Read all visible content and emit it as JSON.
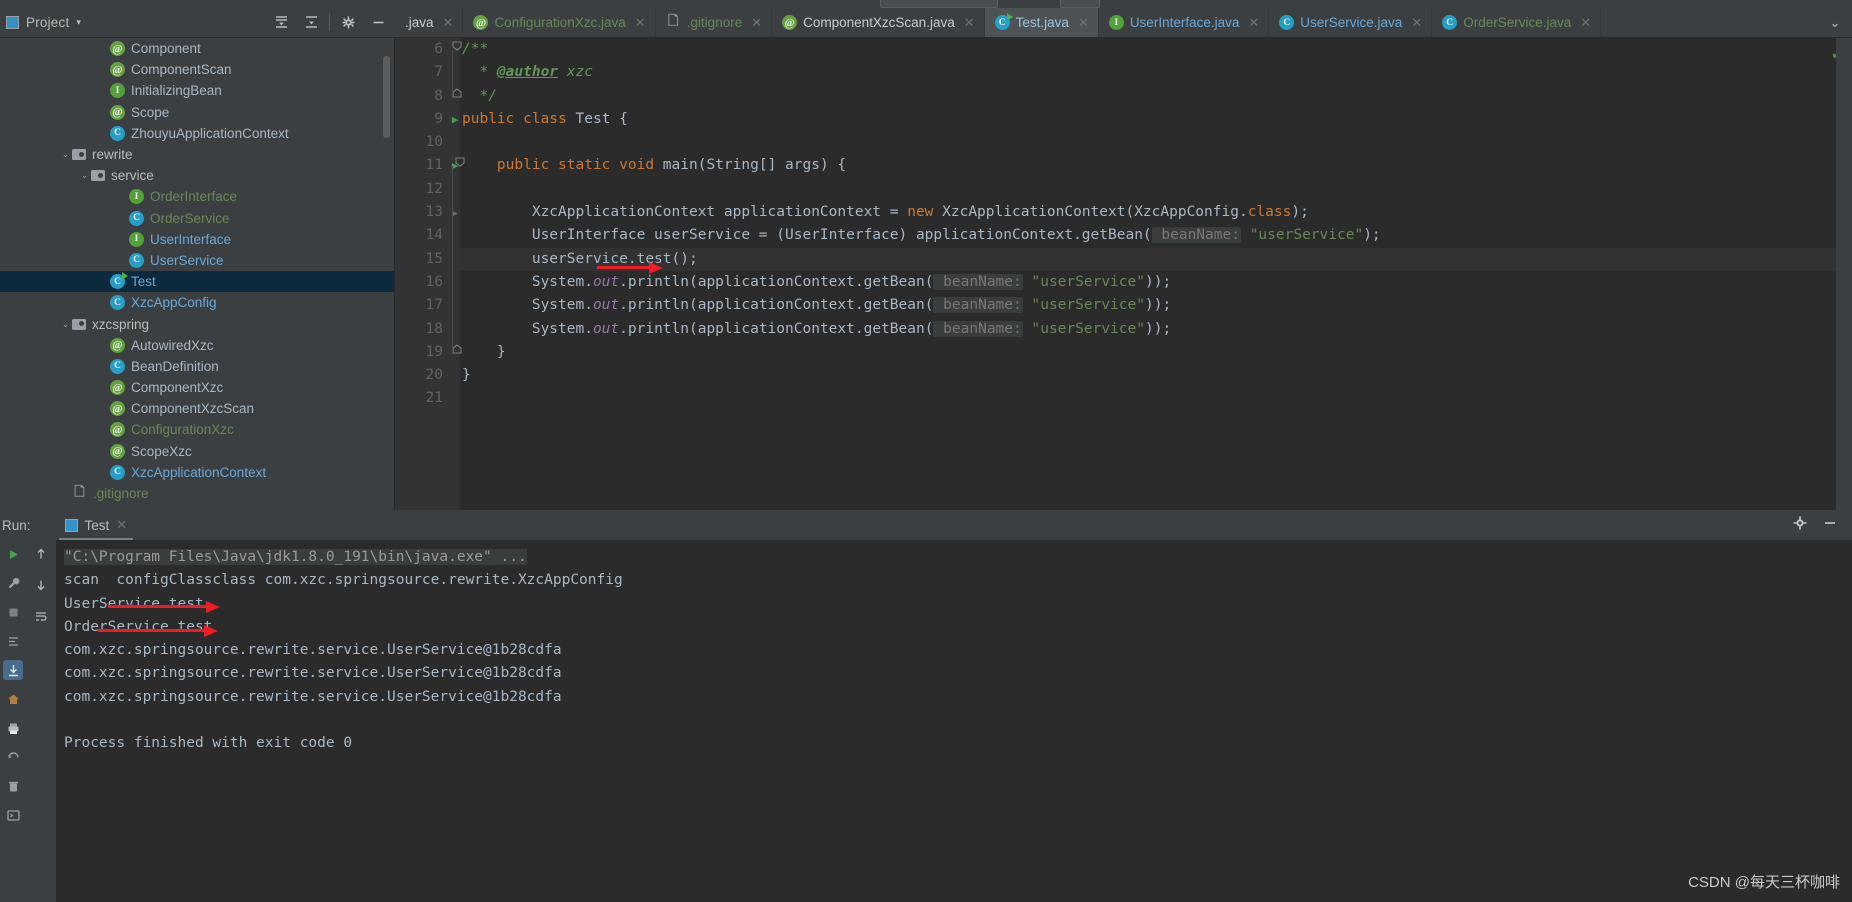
{
  "window": {
    "project_panel_title": "Project",
    "project_caret": "▾"
  },
  "project_toolbar": {
    "expand_all_label": "expand-all",
    "collapse_all_label": "collapse-all",
    "settings_label": "settings",
    "hide_label": "hide"
  },
  "tabs": [
    {
      "label": ".java",
      "icon": "none",
      "color": "white",
      "active": false,
      "close": "✕"
    },
    {
      "label": "ConfigurationXzc.java",
      "icon": "annotation-icon",
      "color": "green",
      "active": false,
      "close": "✕"
    },
    {
      "label": ".gitignore",
      "icon": "gitignore-icon",
      "color": "green",
      "active": false,
      "close": "✕"
    },
    {
      "label": "ComponentXzcScan.java",
      "icon": "annotation-icon",
      "color": "white",
      "active": false,
      "close": "✕"
    },
    {
      "label": "Test.java",
      "icon": "runnable-class-icon",
      "color": "lblue",
      "active": true,
      "close": "✕"
    },
    {
      "label": "UserInterface.java",
      "icon": "interface-icon",
      "color": "blue",
      "active": false,
      "close": "✕"
    },
    {
      "label": "UserService.java",
      "icon": "class-icon",
      "color": "blue",
      "active": false,
      "close": "✕"
    },
    {
      "label": "OrderService.java",
      "icon": "class-icon",
      "color": "green",
      "active": false,
      "close": "✕"
    }
  ],
  "tabs_overflow_icon": "chevron-down-icon",
  "tree": [
    {
      "label": "Component",
      "indent": 3,
      "icon": "annotation-icon",
      "color": "grey",
      "arrow": "",
      "selected": false
    },
    {
      "label": "ComponentScan",
      "indent": 3,
      "icon": "annotation-icon",
      "color": "grey",
      "arrow": "",
      "selected": false
    },
    {
      "label": "InitializingBean",
      "indent": 3,
      "icon": "interface-icon",
      "color": "grey",
      "arrow": "",
      "selected": false
    },
    {
      "label": "Scope",
      "indent": 3,
      "icon": "annotation-icon",
      "color": "grey",
      "arrow": "",
      "selected": false
    },
    {
      "label": "ZhouyuApplicationContext",
      "indent": 3,
      "icon": "class-icon",
      "color": "grey",
      "arrow": "",
      "selected": false
    },
    {
      "label": "rewrite",
      "indent": 1,
      "icon": "folder-icon",
      "color": "plain",
      "arrow": "⌄",
      "selected": false
    },
    {
      "label": "service",
      "indent": 2,
      "icon": "folder-icon",
      "color": "plain",
      "arrow": "⌄",
      "selected": false
    },
    {
      "label": "OrderInterface",
      "indent": 4,
      "icon": "interface-icon",
      "color": "green",
      "arrow": "",
      "selected": false
    },
    {
      "label": "OrderService",
      "indent": 4,
      "icon": "class-icon",
      "color": "green",
      "arrow": "",
      "selected": false
    },
    {
      "label": "UserInterface",
      "indent": 4,
      "icon": "interface-icon",
      "color": "blue",
      "arrow": "",
      "selected": false
    },
    {
      "label": "UserService",
      "indent": 4,
      "icon": "class-icon",
      "color": "blue",
      "arrow": "",
      "selected": false
    },
    {
      "label": "Test",
      "indent": 3,
      "icon": "runnable-class-icon",
      "color": "blue",
      "arrow": "",
      "selected": true
    },
    {
      "label": "XzcAppConfig",
      "indent": 3,
      "icon": "class-icon",
      "color": "blue",
      "arrow": "",
      "selected": false
    },
    {
      "label": "xzcspring",
      "indent": 1,
      "icon": "folder-icon",
      "color": "plain",
      "arrow": "⌄",
      "selected": false
    },
    {
      "label": "AutowiredXzc",
      "indent": 3,
      "icon": "annotation-icon",
      "color": "grey",
      "arrow": "",
      "selected": false
    },
    {
      "label": "BeanDefinition",
      "indent": 3,
      "icon": "class-icon",
      "color": "grey",
      "arrow": "",
      "selected": false
    },
    {
      "label": "ComponentXzc",
      "indent": 3,
      "icon": "annotation-icon",
      "color": "grey",
      "arrow": "",
      "selected": false
    },
    {
      "label": "ComponentXzcScan",
      "indent": 3,
      "icon": "annotation-icon",
      "color": "grey",
      "arrow": "",
      "selected": false
    },
    {
      "label": "ConfigurationXzc",
      "indent": 3,
      "icon": "annotation-icon",
      "color": "green",
      "arrow": "",
      "selected": false
    },
    {
      "label": "ScopeXzc",
      "indent": 3,
      "icon": "annotation-icon",
      "color": "grey",
      "arrow": "",
      "selected": false
    },
    {
      "label": "XzcApplicationContext",
      "indent": 3,
      "icon": "class-icon",
      "color": "blue",
      "arrow": "",
      "selected": false
    },
    {
      "label": ".gitignore",
      "indent": 1,
      "icon": "gitignore-icon",
      "color": "green",
      "arrow": "",
      "selected": false
    }
  ],
  "editor": {
    "first_line_number": 6,
    "lines": [
      {
        "n": 6,
        "gutter": "fold-start",
        "html": "<span class='cmt'>/**</span>"
      },
      {
        "n": 7,
        "gutter": "",
        "html": "<span class='cmt'>  * </span><span class='cmt-tag'>@author</span><span class='cmt'> xzc</span>"
      },
      {
        "n": 8,
        "gutter": "fold-end",
        "html": "<span class='cmt'>  */</span>"
      },
      {
        "n": 9,
        "gutter": "run",
        "html": "<span class='k'>public class </span><span class='cls-nm'>Test </span>{"
      },
      {
        "n": 10,
        "gutter": "",
        "html": ""
      },
      {
        "n": 11,
        "gutter": "run-fold",
        "html": "    <span class='k'>public static void </span>main(<span class='cls-nm'>String</span>[] args) {"
      },
      {
        "n": 12,
        "gutter": "",
        "html": ""
      },
      {
        "n": 13,
        "gutter": "fold-small",
        "html": "        XzcApplicationContext applicationContext = <span class='k'>new </span>XzcApplicationContext(XzcAppConfig.<span class='k'>class</span>);"
      },
      {
        "n": 14,
        "gutter": "",
        "html": "        UserInterface userService = (UserInterface) applicationContext.getBean(<span class='hint'> beanName:</span> <span class='s'>\"userService\"</span>);"
      },
      {
        "n": 15,
        "gutter": "",
        "html": "        userService.test();",
        "current": true
      },
      {
        "n": 16,
        "gutter": "",
        "html": "        System.<span class='fld'>out</span>.println(applicationContext.getBean(<span class='hint'> beanName:</span> <span class='s'>\"userService\"</span>));"
      },
      {
        "n": 17,
        "gutter": "",
        "html": "        System.<span class='fld'>out</span>.println(applicationContext.getBean(<span class='hint'> beanName:</span> <span class='s'>\"userService\"</span>));"
      },
      {
        "n": 18,
        "gutter": "",
        "html": "        System.<span class='fld'>out</span>.println(applicationContext.getBean(<span class='hint'> beanName:</span> <span class='s'>\"userService\"</span>));"
      },
      {
        "n": 19,
        "gutter": "fold-end2",
        "html": "    }"
      },
      {
        "n": 20,
        "gutter": "",
        "html": "}"
      },
      {
        "n": 21,
        "gutter": "",
        "html": ""
      }
    ],
    "inspection_status_icon": "checkmark-ok-icon"
  },
  "run_panel": {
    "run_label": "Run:",
    "tab_label": "Test",
    "tab_close": "✕",
    "settings_icon": "gear-icon",
    "hide_icon": "minimize-icon",
    "toolbar_icons": [
      "rerun-icon",
      "wrench-icon",
      "stop-icon",
      "layout-icon",
      "print-icon",
      "export-icon",
      "trash-icon",
      "console-icon"
    ],
    "gutter_icons": [
      "scroll-up-icon",
      "scroll-down-icon",
      "soft-wrap-icon",
      "scroll-to-end-icon",
      "home-icon",
      "print-icon",
      "restore-icon",
      "trash-icon"
    ],
    "console_lines": [
      {
        "text": "\"C:\\Program Files\\Java\\jdk1.8.0_191\\bin\\java.exe\" ...",
        "style": "cmd"
      },
      {
        "text": "scan  configClassclass com.xzc.springsource.rewrite.XzcAppConfig",
        "style": "normal"
      },
      {
        "text": "UserService test",
        "style": "normal"
      },
      {
        "text": "OrderService test",
        "style": "normal"
      },
      {
        "text": "com.xzc.springsource.rewrite.service.UserService@1b28cdfa",
        "style": "normal"
      },
      {
        "text": "com.xzc.springsource.rewrite.service.UserService@1b28cdfa",
        "style": "normal"
      },
      {
        "text": "com.xzc.springsource.rewrite.service.UserService@1b28cdfa",
        "style": "normal"
      },
      {
        "text": "",
        "style": "normal"
      },
      {
        "text": "Process finished with exit code 0",
        "style": "normal"
      }
    ]
  },
  "annotations": {
    "arrow_color": "#ee1c25",
    "arrows": [
      {
        "name": "arrow-editor-userservice-test"
      },
      {
        "name": "arrow-console-userservice-test"
      },
      {
        "name": "arrow-console-orderservice-test"
      }
    ]
  },
  "watermark": {
    "text": "CSDN @每天三杯咖啡"
  },
  "colors": {
    "panel_bg": "#3c3f41",
    "editor_bg": "#2b2b2b",
    "selection_bg": "#0d293e",
    "keyword": "#cc7832",
    "string": "#6a8759",
    "comment": "#629755",
    "text": "#a9b7c6",
    "accent_blue": "#3592c4",
    "annotation_red": "#ee1c25"
  }
}
